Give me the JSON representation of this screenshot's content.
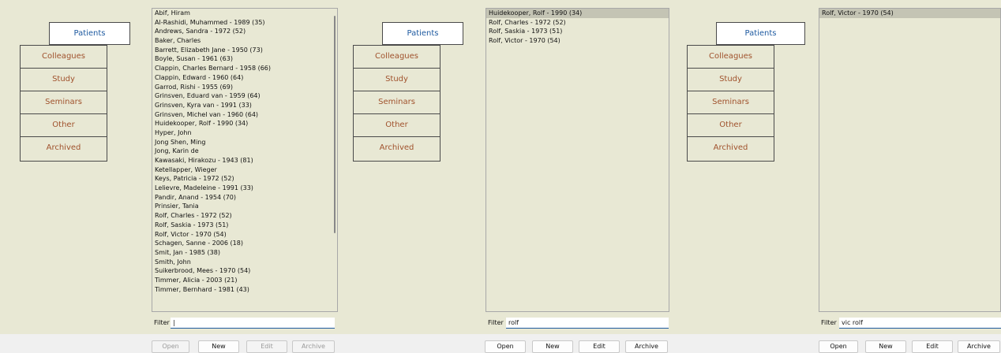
{
  "tabs": [
    "Patients",
    "Colleagues",
    "Study",
    "Seminars",
    "Other",
    "Archived"
  ],
  "filter_label": "Filter",
  "buttons": {
    "open": "Open",
    "new": "New",
    "edit": "Edit",
    "archive": "Archive"
  },
  "panel1": {
    "filter_value": "|",
    "rows": [
      "Abif, Hiram",
      "Al-Rashidi, Muhammed - 1989 (35)",
      "Andrews, Sandra - 1972 (52)",
      "Baker, Charles",
      "Barrett, Elizabeth Jane - 1950 (73)",
      "Boyle, Susan - 1961 (63)",
      "Clappin, Charles Bernard - 1958 (66)",
      "Clappin, Edward - 1960 (64)",
      "Garrod, Rishi - 1955 (69)",
      "Grinsven, Eduard van - 1959 (64)",
      "Grinsven, Kyra van - 1991 (33)",
      "Grinsven, Michel van - 1960 (64)",
      "Huidekooper, Rolf - 1990 (34)",
      "Hyper, John",
      "Jong Shen, Ming",
      "Jong, Karin de",
      "Kawasaki, Hirakozu - 1943 (81)",
      "Ketellapper, Wieger",
      "Keys, Patricia - 1972 (52)",
      "Lelievre, Madeleine - 1991 (33)",
      "Pandir, Anand - 1954 (70)",
      "Prinsier, Tania",
      "Rolf, Charles - 1972 (52)",
      "Rolf, Saskia - 1973 (51)",
      "Rolf, Victor - 1970 (54)",
      "Schagen, Sanne - 2006 (18)",
      "Smit, Jan - 1985 (38)",
      "Smith, John",
      "Suikerbrood, Mees - 1970 (54)",
      "Timmer, Alicia - 2003 (21)",
      "Timmer, Bernhard - 1981 (43)"
    ]
  },
  "panel2": {
    "filter_value": "rolf",
    "rows": [
      "Huidekooper, Rolf - 1990 (34)",
      "Rolf, Charles - 1972 (52)",
      "Rolf, Saskia - 1973 (51)",
      "Rolf, Victor - 1970 (54)"
    ]
  },
  "panel3": {
    "filter_value": "vic rolf",
    "rows": [
      "Rolf, Victor - 1970 (54)"
    ]
  }
}
